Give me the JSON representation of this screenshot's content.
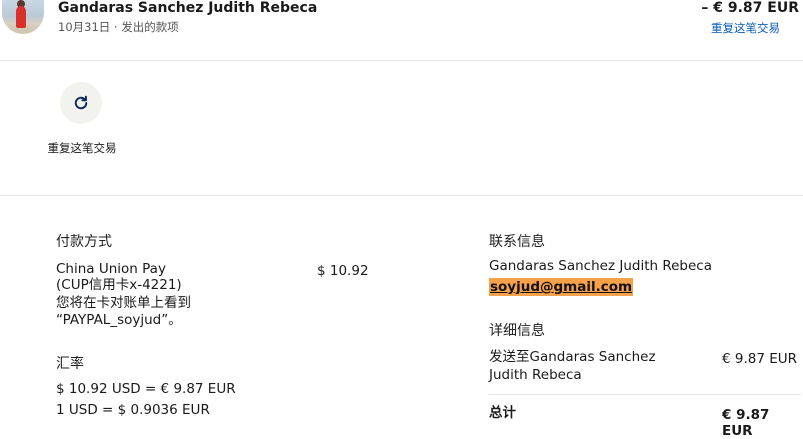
{
  "header": {
    "name": "Gandaras Sanchez Judith Rebeca",
    "subtitle": "10月31日 · 发出的款项",
    "amount": "– € 9.87 EUR",
    "repeat_link": "重复这笔交易"
  },
  "action": {
    "repeat_label": "重复这笔交易"
  },
  "payment": {
    "heading": "付款方式",
    "method_line1": "China Union Pay",
    "method_line2": "(CUP信用卡x-4221)",
    "statement_line1": "您将在卡对账单上看到",
    "statement_line2": "“PAYPAL_soyjud”。",
    "amount": "$ 10.92"
  },
  "exchange": {
    "heading": "汇率",
    "line1": "$ 10.92 USD = € 9.87 EUR",
    "line2": "1 USD = $ 0.9036 EUR"
  },
  "contact": {
    "heading": "联系信息",
    "name": "Gandaras Sanchez Judith Rebeca",
    "email": "soyjud@gmail.com"
  },
  "details": {
    "heading": "详细信息",
    "sent_line1": "发送至Gandaras Sanchez",
    "sent_line2": "Judith Rebeca",
    "sent_amount": "€ 9.87 EUR",
    "total_label": "总计",
    "total_amount": "€ 9.87 EUR"
  },
  "colors": {
    "link": "#0a5bb5",
    "email_highlight": "#f7a14a",
    "divider": "#e6e6e6"
  },
  "icons": [
    "avatar-photo",
    "refresh-icon"
  ]
}
